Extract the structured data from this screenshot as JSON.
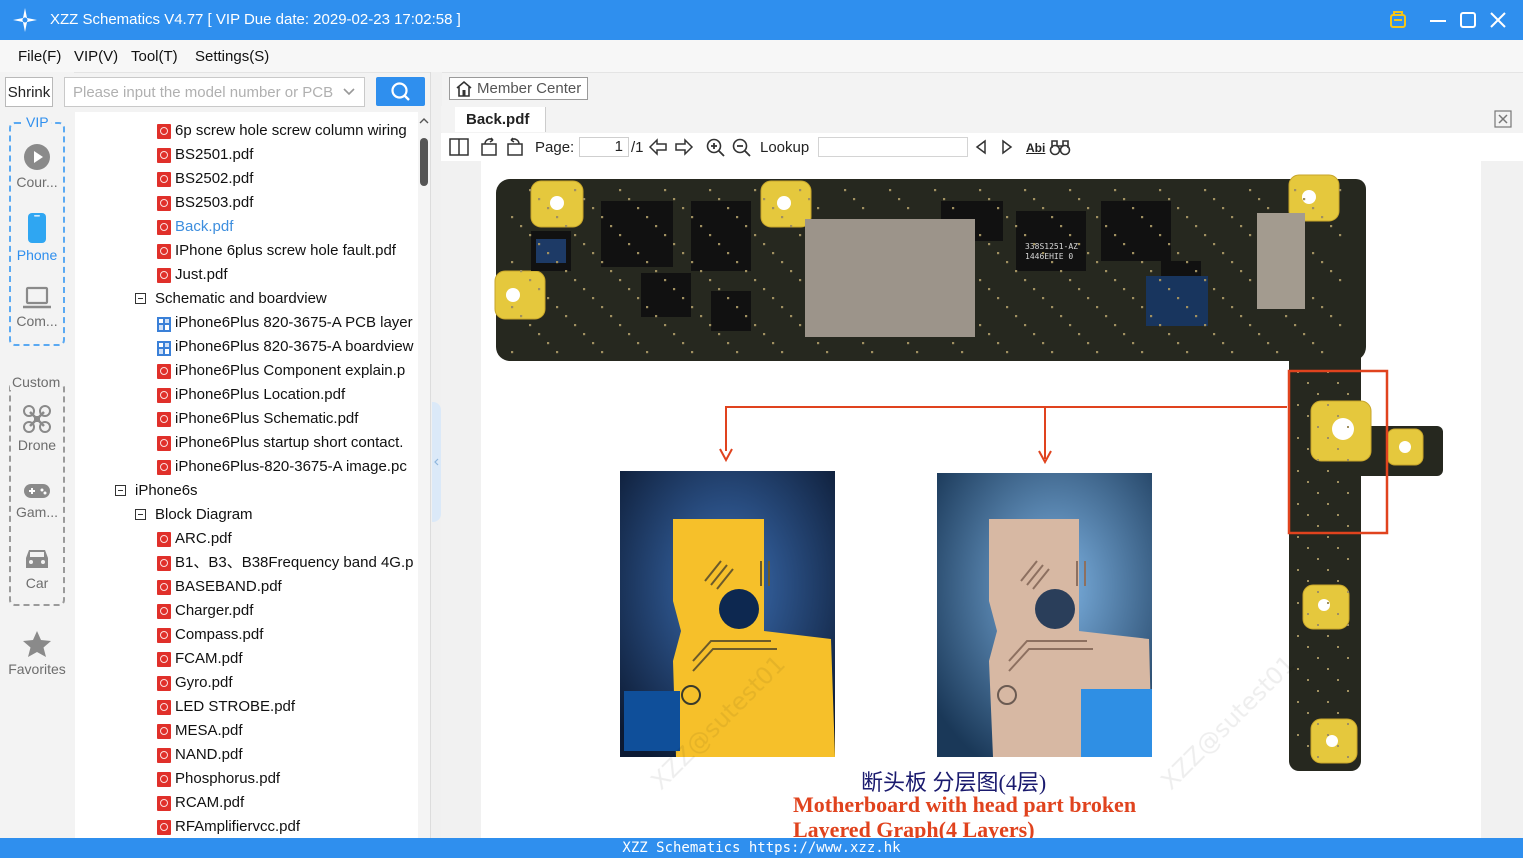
{
  "window": {
    "title": "XZZ Schematics V4.77 [ VIP Due date: 2029-02-23 17:02:58 ]"
  },
  "menu": [
    "File(F)",
    "VIP(V)",
    "Tool(T)",
    "Settings(S)"
  ],
  "sidebar": {
    "shrink_label": "Shrink",
    "vip_label": "VIP",
    "vip_items": [
      {
        "label": "Cour...",
        "icon": "play-icon"
      },
      {
        "label": "Phone",
        "icon": "phone-icon",
        "active": true
      },
      {
        "label": "Com...",
        "icon": "laptop-icon"
      }
    ],
    "custom_label": "Custom",
    "custom_items": [
      {
        "label": "Drone",
        "icon": "drone-icon"
      },
      {
        "label": "Gam...",
        "icon": "gamepad-icon"
      },
      {
        "label": "Car",
        "icon": "car-icon"
      }
    ],
    "favorites_label": "Favorites"
  },
  "search": {
    "placeholder": "Please input the model number or PCB"
  },
  "tree": {
    "rows": [
      {
        "label": "6p screw hole screw column wiring",
        "type": "pdf",
        "level": 2
      },
      {
        "label": "BS2501.pdf",
        "type": "pdf",
        "level": 2
      },
      {
        "label": "BS2502.pdf",
        "type": "pdf",
        "level": 2
      },
      {
        "label": "BS2503.pdf",
        "type": "pdf",
        "level": 2
      },
      {
        "label": "Back.pdf",
        "type": "pdf",
        "level": 2,
        "selected": true
      },
      {
        "label": "IPhone 6plus screw hole fault.pdf",
        "type": "pdf",
        "level": 2
      },
      {
        "label": "Just.pdf",
        "type": "pdf",
        "level": 2
      },
      {
        "label": "Schematic and boardview",
        "type": "folder",
        "level": 1
      },
      {
        "label": "iPhone6Plus 820-3675-A PCB layer",
        "type": "bv",
        "level": 2
      },
      {
        "label": "iPhone6Plus 820-3675-A boardview",
        "type": "bv",
        "level": 2
      },
      {
        "label": "iPhone6Plus Component explain.p",
        "type": "pdf",
        "level": 2
      },
      {
        "label": "iPhone6Plus Location.pdf",
        "type": "pdf",
        "level": 2
      },
      {
        "label": "iPhone6Plus Schematic.pdf",
        "type": "pdf",
        "level": 2
      },
      {
        "label": "iPhone6Plus startup short contact.",
        "type": "pdf",
        "level": 2
      },
      {
        "label": "iPhone6Plus-820-3675-A image.pc",
        "type": "pdf",
        "level": 2
      },
      {
        "label": "iPhone6s",
        "type": "folder",
        "level": 0
      },
      {
        "label": "Block Diagram",
        "type": "folder",
        "level": 1
      },
      {
        "label": "ARC.pdf",
        "type": "pdf",
        "level": 2
      },
      {
        "label": "B1、B3、B38Frequency band 4G.p",
        "type": "pdf",
        "level": 2
      },
      {
        "label": "BASEBAND.pdf",
        "type": "pdf",
        "level": 2
      },
      {
        "label": "Charger.pdf",
        "type": "pdf",
        "level": 2
      },
      {
        "label": "Compass.pdf",
        "type": "pdf",
        "level": 2
      },
      {
        "label": "FCAM.pdf",
        "type": "pdf",
        "level": 2
      },
      {
        "label": "Gyro.pdf",
        "type": "pdf",
        "level": 2
      },
      {
        "label": "LED STROBE.pdf",
        "type": "pdf",
        "level": 2
      },
      {
        "label": "MESA.pdf",
        "type": "pdf",
        "level": 2
      },
      {
        "label": "NAND.pdf",
        "type": "pdf",
        "level": 2
      },
      {
        "label": "Phosphorus.pdf",
        "type": "pdf",
        "level": 2
      },
      {
        "label": "RCAM.pdf",
        "type": "pdf",
        "level": 2
      },
      {
        "label": "RFAmplifiervcc.pdf",
        "type": "pdf",
        "level": 2
      }
    ]
  },
  "viewer": {
    "member_center": "Member Center",
    "tab": "Back.pdf",
    "page_label": "Page:",
    "page_current": "1",
    "page_total": "/1",
    "lookup_label": "Lookup",
    "lookup_value": "",
    "abi_label": "Abi"
  },
  "document": {
    "chip_labels": [
      "338S1251-AZ",
      "1446EHIE 0"
    ],
    "caption_cn": "断头板 分层图(4层)",
    "caption_en1": "Motherboard with head part broken",
    "caption_en2": "Layered Graph(4 Layers)",
    "watermark": "XZZ@sutest01",
    "accent": "#e0431e"
  },
  "status": {
    "text": "XZZ Schematics https://www.xzz.hk"
  }
}
